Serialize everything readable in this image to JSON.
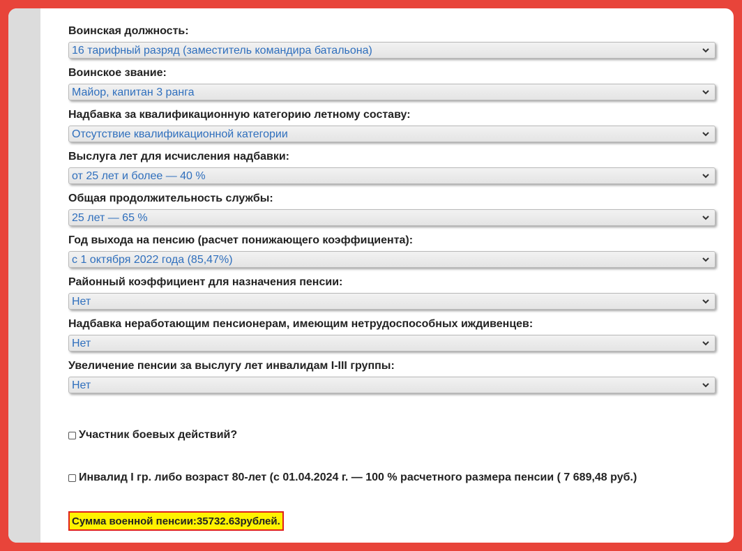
{
  "fields": [
    {
      "label": "Воинская должность:",
      "value": "16 тарифный разряд (заместитель командира батальона)"
    },
    {
      "label": "Воинское звание:",
      "value": "Майор, капитан 3 ранга"
    },
    {
      "label": "Надбавка за квалификационную категорию летному составу:",
      "value": "Отсутствие квалификационной категории"
    },
    {
      "label": "Выслуга лет для исчисления надбавки:",
      "value": "от 25 лет и более — 40 %"
    },
    {
      "label": "Общая продолжительность службы:",
      "value": "25 лет — 65 %"
    },
    {
      "label": "Год выхода на пенсию (расчет понижающего коэффициента):",
      "value": "с 1 октября 2022 года (85,47%)"
    },
    {
      "label": "Районный коэффициент для назначения пенсии:",
      "value": "Нет"
    },
    {
      "label": "Надбавка неработающим пенсионерам, имеющим нетрудоспособных иждивенцев:",
      "value": "Нет"
    },
    {
      "label": "Увеличение пенсии за выслугу лет инвалидам I-III группы:",
      "value": "Нет"
    }
  ],
  "checkboxes": {
    "combat": {
      "label": "Участник боевых действий?",
      "checked": false
    },
    "invalid": {
      "label": "Инвалид I гр. либо возраст 80-лет (с 01.04.2024 г. — 100 % расчетного размера пенсии ( 7 689,48 руб.)",
      "checked": false
    }
  },
  "result": {
    "label": "Сумма военной пенсии:",
    "amount": "35732.63",
    "unit": "рублей."
  },
  "colors": {
    "outer_border": "#e8443a",
    "select_text": "#2f6fbd",
    "result_bg": "#fff200",
    "result_border": "#e0201a"
  },
  "icons": {
    "select_arrow": "chevron-down-icon"
  }
}
